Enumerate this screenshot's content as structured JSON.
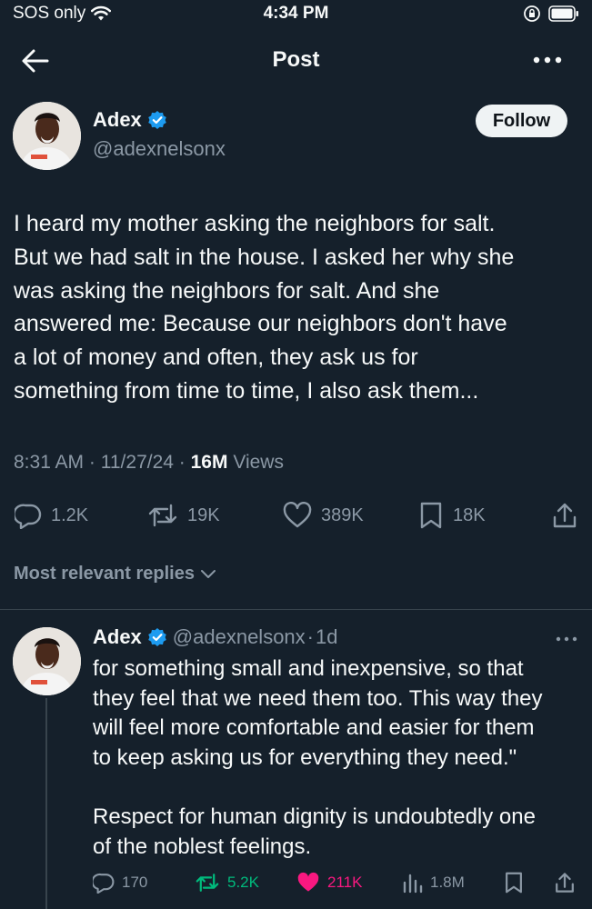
{
  "status_bar": {
    "carrier": "SOS only",
    "time": "4:34 PM"
  },
  "header": {
    "title": "Post"
  },
  "post": {
    "author_name": "Adex",
    "handle": "@adexnelsonx",
    "follow_label": "Follow",
    "text_lines": [
      "I heard my mother asking the neighbors for salt.",
      "But we had salt in the house. I asked her why she",
      "was asking the neighbors for salt. And she",
      "answered me: Because our neighbors don't have",
      "a lot of money and often, they ask us for",
      "something from time to time, I also ask them..."
    ],
    "time": "8:31 AM",
    "date": "11/27/24",
    "views_count": "16M",
    "views_label": "Views",
    "stats": {
      "replies": "1.2K",
      "reposts": "19K",
      "likes": "389K",
      "bookmarks": "18K"
    }
  },
  "replies_header": {
    "label": "Most relevant replies"
  },
  "reply": {
    "author_name": "Adex",
    "handle": "@adexnelsonx",
    "age": "1d",
    "text_lines": [
      "for something small and inexpensive, so that",
      "they feel that we need them too. This way they",
      "will feel more comfortable and easier for them",
      "to keep asking us for everything they need.\"",
      "",
      "Respect for human dignity is undoubtedly one",
      "of the noblest feelings."
    ],
    "stats": {
      "replies": "170",
      "reposts": "5.2K",
      "likes": "211K",
      "views": "1.8M"
    }
  },
  "colors": {
    "background": "#15202b",
    "text": "#f7f9f9",
    "muted": "#8b98a5",
    "verified": "#1d9bf0",
    "repost_active": "#00ba7c",
    "like_active": "#f91880",
    "divider": "#38444d"
  }
}
